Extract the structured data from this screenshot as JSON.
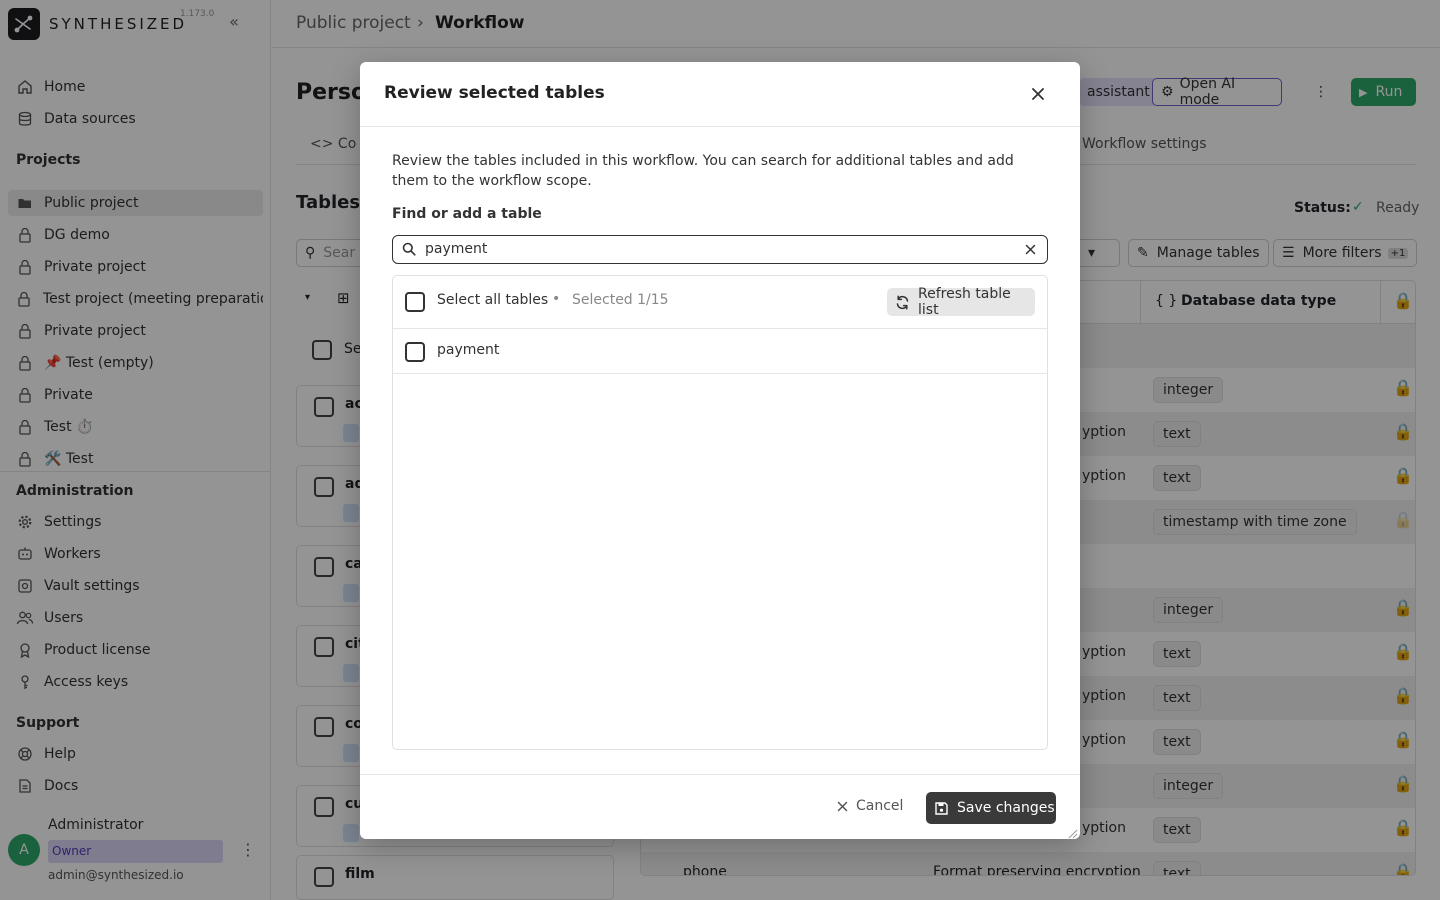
{
  "sidebar": {
    "brand": "SYNTHESIZED",
    "version": "1.173.0",
    "top_items": [
      {
        "label": "Home",
        "icon": "home-icon"
      },
      {
        "label": "Data sources",
        "icon": "database-icon"
      }
    ],
    "projects_heading": "Projects",
    "projects": [
      {
        "label": "Public project",
        "icon": "folder-open-icon",
        "active": true
      },
      {
        "label": "DG demo",
        "icon": "lock-icon"
      },
      {
        "label": "Private project",
        "icon": "lock-icon"
      },
      {
        "label": "Test project (meeting preparation",
        "icon": "lock-icon"
      },
      {
        "label": "Private project",
        "icon": "lock-icon"
      },
      {
        "label": "📌 Test (empty)",
        "icon": "lock-icon"
      },
      {
        "label": "Private",
        "icon": "lock-icon"
      },
      {
        "label": "Test ⏱️",
        "icon": "lock-icon"
      },
      {
        "label": "🛠️ Test",
        "icon": "lock-icon"
      }
    ],
    "admin_heading": "Administration",
    "admin_items": [
      {
        "label": "Settings",
        "icon": "gear-icon"
      },
      {
        "label": "Workers",
        "icon": "workers-icon"
      },
      {
        "label": "Vault settings",
        "icon": "vault-icon"
      },
      {
        "label": "Users",
        "icon": "users-icon"
      },
      {
        "label": "Product license",
        "icon": "license-icon"
      },
      {
        "label": "Access keys",
        "icon": "key-icon"
      }
    ],
    "support_heading": "Support",
    "support_items": [
      {
        "label": "Help",
        "icon": "help-icon"
      },
      {
        "label": "Docs",
        "icon": "docs-icon"
      }
    ],
    "user": {
      "initial": "A",
      "name": "Administrator",
      "role": "Owner",
      "email": "admin@synthesized.io"
    }
  },
  "topbar": {
    "breadcrumb_parent": "Public project",
    "breadcrumb_current": "Workflow"
  },
  "background": {
    "page_title": "Person",
    "tab_code": "Co",
    "tab_settings": "Workflow settings",
    "assistant_label": "assistant",
    "ai_mode_label": "Open AI mode",
    "run_label": "Run",
    "tables_title": "Tables",
    "status_label": "Status:",
    "status_value": "Ready",
    "search_placeholder": "Sear",
    "manage_tables_label": "Manage tables",
    "more_filters_label": "More filters",
    "more_filters_count": "+1",
    "select_label": "Se",
    "db_type_header": "Database data type",
    "cards": [
      "ac",
      "ad",
      "ca",
      "cit",
      "co",
      "cu",
      "film"
    ],
    "rows": [
      {
        "enc": "",
        "type": "integer"
      },
      {
        "enc": "yption",
        "type": "text"
      },
      {
        "enc": "yption",
        "type": "text"
      },
      {
        "enc": "",
        "type": "timestamp with time zone"
      },
      {
        "enc": "",
        "type": ""
      },
      {
        "enc": "",
        "type": "integer"
      },
      {
        "enc": "yption",
        "type": "text"
      },
      {
        "enc": "yption",
        "type": "text"
      },
      {
        "enc": "yption",
        "type": "text"
      },
      {
        "enc": "",
        "type": "integer"
      },
      {
        "enc": "yption",
        "type": "text"
      },
      {
        "enc": "Format preserving encryption",
        "type": "text",
        "name": "phone"
      }
    ]
  },
  "modal": {
    "title": "Review selected tables",
    "description": "Review the tables included in this workflow. You can search for additional tables and add them to the workflow scope.",
    "search_label": "Find or add a table",
    "search_value": "payment",
    "select_all_label": "Select all tables",
    "selected_count": "Selected 1/15",
    "refresh_label": "Refresh table list",
    "rows": [
      {
        "label": "payment",
        "checked": false
      }
    ],
    "cancel_label": "Cancel",
    "save_label": "Save changes"
  },
  "colors": {
    "accent_green": "#2da86a",
    "owner_badge_bg": "#dcd6f7",
    "lock_gold": "#b8930e",
    "save_btn_bg": "#3a3a3a"
  }
}
